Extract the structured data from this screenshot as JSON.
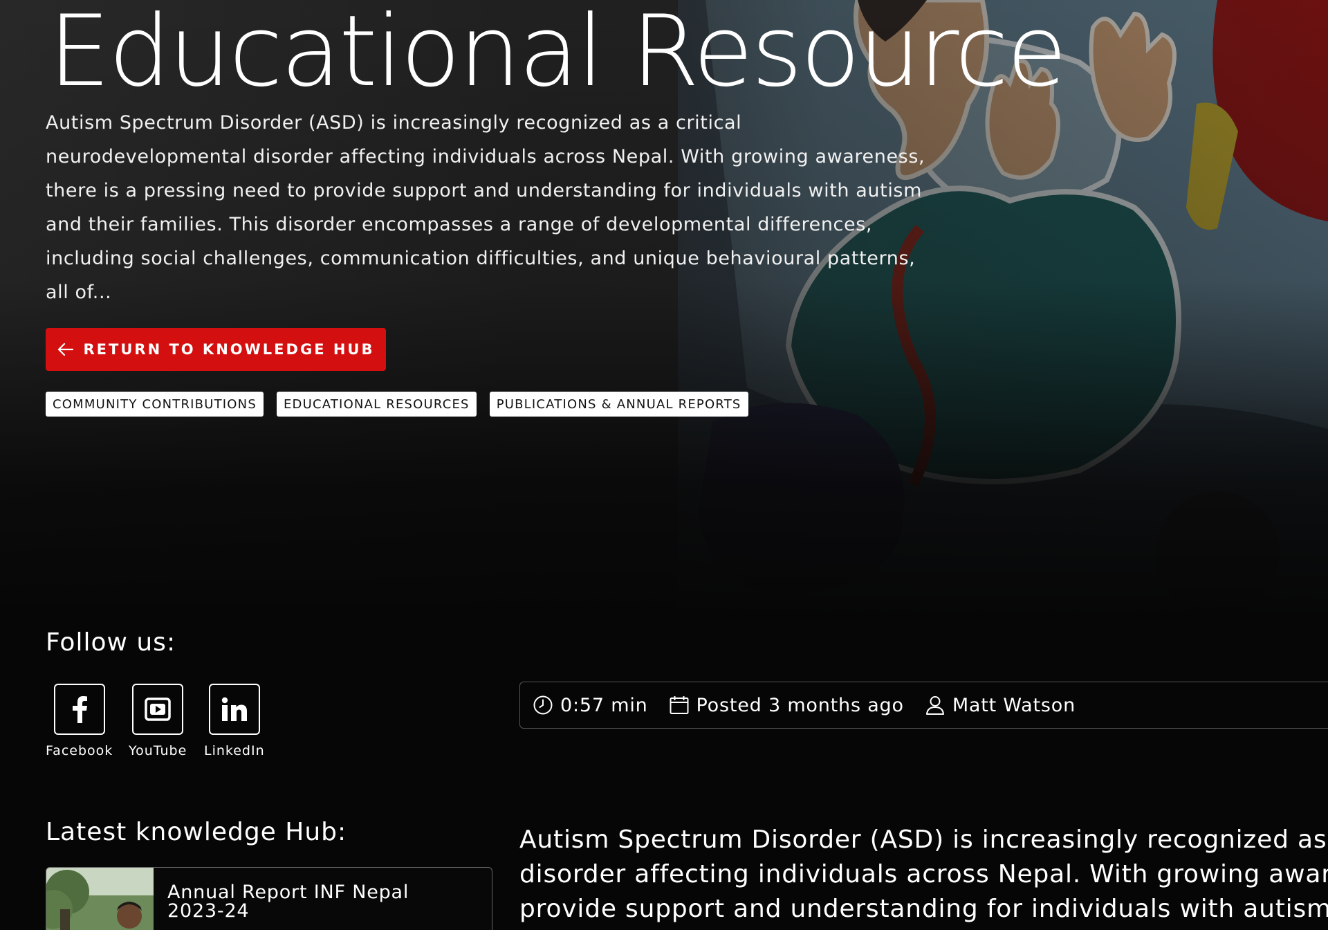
{
  "hero": {
    "title": "Educational Resource",
    "excerpt": "Autism Spectrum Disorder (ASD) is increasingly recognized as a critical neurodevelopmental disorder affecting individuals across Nepal. With growing awareness, there is a pressing need to provide support and understanding for individuals with autism and their families. This disorder encompasses a range of developmental differences, including social challenges, communication difficulties, and unique behavioural patterns, all of...",
    "return_button": {
      "label": "RETURN TO KNOWLEDGE HUB",
      "icon": "arrow-left-icon"
    },
    "tags": [
      "COMMUNITY CONTRIBUTIONS",
      "EDUCATIONAL RESOURCES",
      "PUBLICATIONS & ANNUAL REPORTS"
    ],
    "accent_color": "#d40f0f"
  },
  "follow": {
    "title": "Follow us:",
    "networks": [
      {
        "label": "Facebook",
        "icon": "facebook-icon"
      },
      {
        "label": "YouTube",
        "icon": "youtube-icon"
      },
      {
        "label": "LinkedIn",
        "icon": "linkedin-icon"
      }
    ]
  },
  "meta": {
    "read_time": "0:57 min",
    "posted": "Posted 3 months ago",
    "author": "Matt Watson",
    "icons": [
      "clock-icon",
      "calendar-icon",
      "user-icon"
    ]
  },
  "latest": {
    "title": "Latest knowledge Hub:",
    "items": [
      {
        "title_line1": "Annual Report INF Nepal",
        "title_line2": "2023-24"
      }
    ]
  },
  "article": {
    "lines": [
      "Autism Spectrum Disorder (ASD) is increasingly recognized as a critical neurodevelopmental",
      "disorder affecting individuals across Nepal. With growing awareness, there is a pressing need to",
      "provide support and understanding for individuals with autism and their families."
    ]
  }
}
